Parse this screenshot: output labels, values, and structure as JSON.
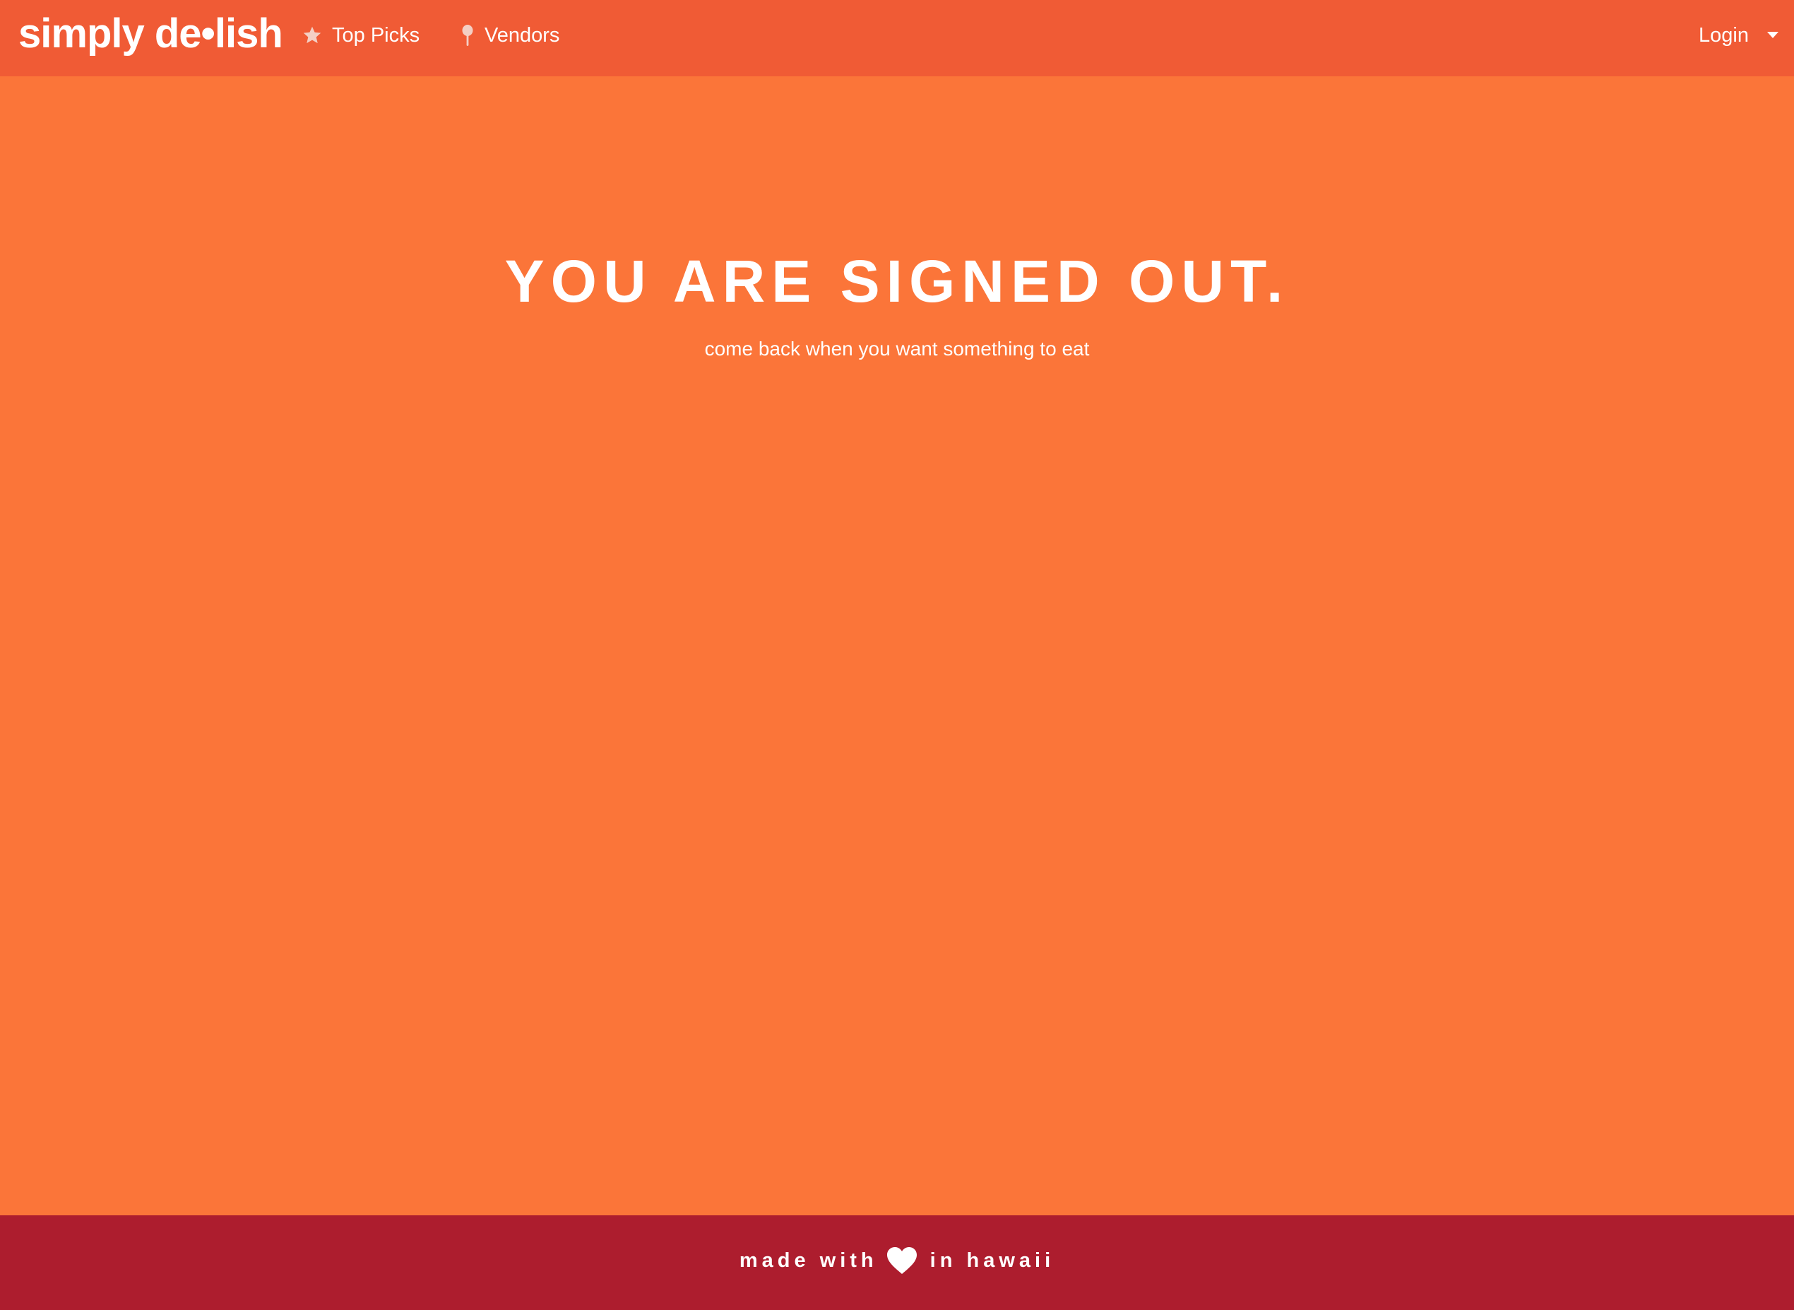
{
  "navbar": {
    "brand": "simply de•lish",
    "items": [
      {
        "label": "Top Picks",
        "icon": "star-icon"
      },
      {
        "label": "Vendors",
        "icon": "map-pin-icon"
      }
    ],
    "login": {
      "label": "Login",
      "icon": "caret-down-icon"
    }
  },
  "main": {
    "headline": "YOU ARE SIGNED OUT.",
    "subline": "come back when you want something to eat"
  },
  "footer": {
    "before": "made with",
    "icon": "heart-icon",
    "after": "in hawaii"
  },
  "colors": {
    "navbar_bg": "#f05b35",
    "page_bg": "#fb7539",
    "footer_bg": "#ad1d2e",
    "text": "#ffffff"
  }
}
